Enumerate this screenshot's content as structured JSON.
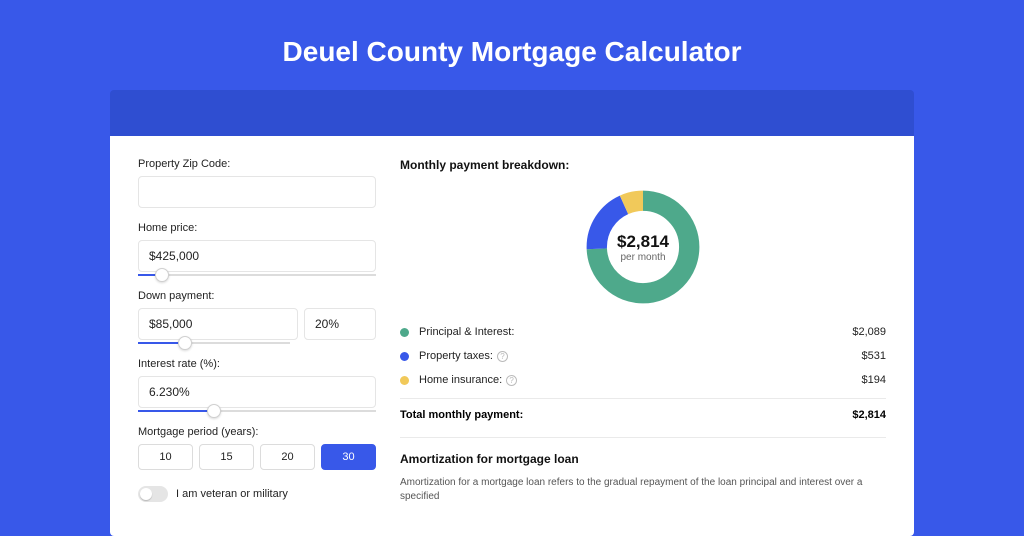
{
  "title": "Deuel County Mortgage Calculator",
  "colors": {
    "principal": "#4ea98b",
    "taxes": "#3858e9",
    "insurance": "#f1c95a"
  },
  "left": {
    "zip": {
      "label": "Property Zip Code:",
      "value": ""
    },
    "home_price": {
      "label": "Home price:",
      "value": "$425,000",
      "slider_pct": 10
    },
    "down_payment": {
      "label": "Down payment:",
      "value": "$85,000",
      "pct_value": "20%",
      "slider_pct": 20
    },
    "interest_rate": {
      "label": "Interest rate (%):",
      "value": "6.230%",
      "slider_pct": 32
    },
    "period": {
      "label": "Mortgage period (years):",
      "options": [
        "10",
        "15",
        "20",
        "30"
      ],
      "selected": "30"
    },
    "veteran": {
      "label": "I am veteran or military",
      "on": false
    }
  },
  "right": {
    "breakdown_title": "Monthly payment breakdown:",
    "donut": {
      "amount": "$2,814",
      "sub": "per month"
    },
    "items": [
      {
        "label": "Principal & Interest:",
        "value": "$2,089",
        "color": "#4ea98b",
        "info": false
      },
      {
        "label": "Property taxes:",
        "value": "$531",
        "color": "#3858e9",
        "info": true
      },
      {
        "label": "Home insurance:",
        "value": "$194",
        "color": "#f1c95a",
        "info": true
      }
    ],
    "total": {
      "label": "Total monthly payment:",
      "value": "$2,814"
    },
    "amortization": {
      "title": "Amortization for mortgage loan",
      "text": "Amortization for a mortgage loan refers to the gradual repayment of the loan principal and interest over a specified"
    }
  },
  "chart_data": {
    "type": "pie",
    "title": "Monthly payment breakdown",
    "series": [
      {
        "name": "Principal & Interest",
        "value": 2089
      },
      {
        "name": "Property taxes",
        "value": 531
      },
      {
        "name": "Home insurance",
        "value": 194
      }
    ],
    "total": 2814
  }
}
